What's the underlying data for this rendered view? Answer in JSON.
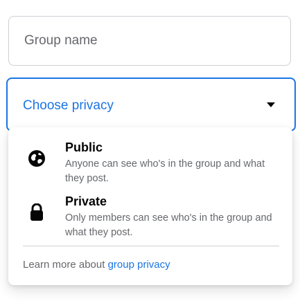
{
  "group_name": {
    "placeholder": "Group name",
    "value": ""
  },
  "privacy_select": {
    "label": "Choose privacy",
    "accent_color": "#1b74e4"
  },
  "privacy_options": [
    {
      "title": "Public",
      "description": "Anyone can see who's in the group and what they post.",
      "icon": "globe-icon"
    },
    {
      "title": "Private",
      "description": "Only members can see who's in the group and what they post.",
      "icon": "lock-icon"
    }
  ],
  "learn_more": {
    "prefix": "Learn more about ",
    "link_text": "group privacy"
  }
}
